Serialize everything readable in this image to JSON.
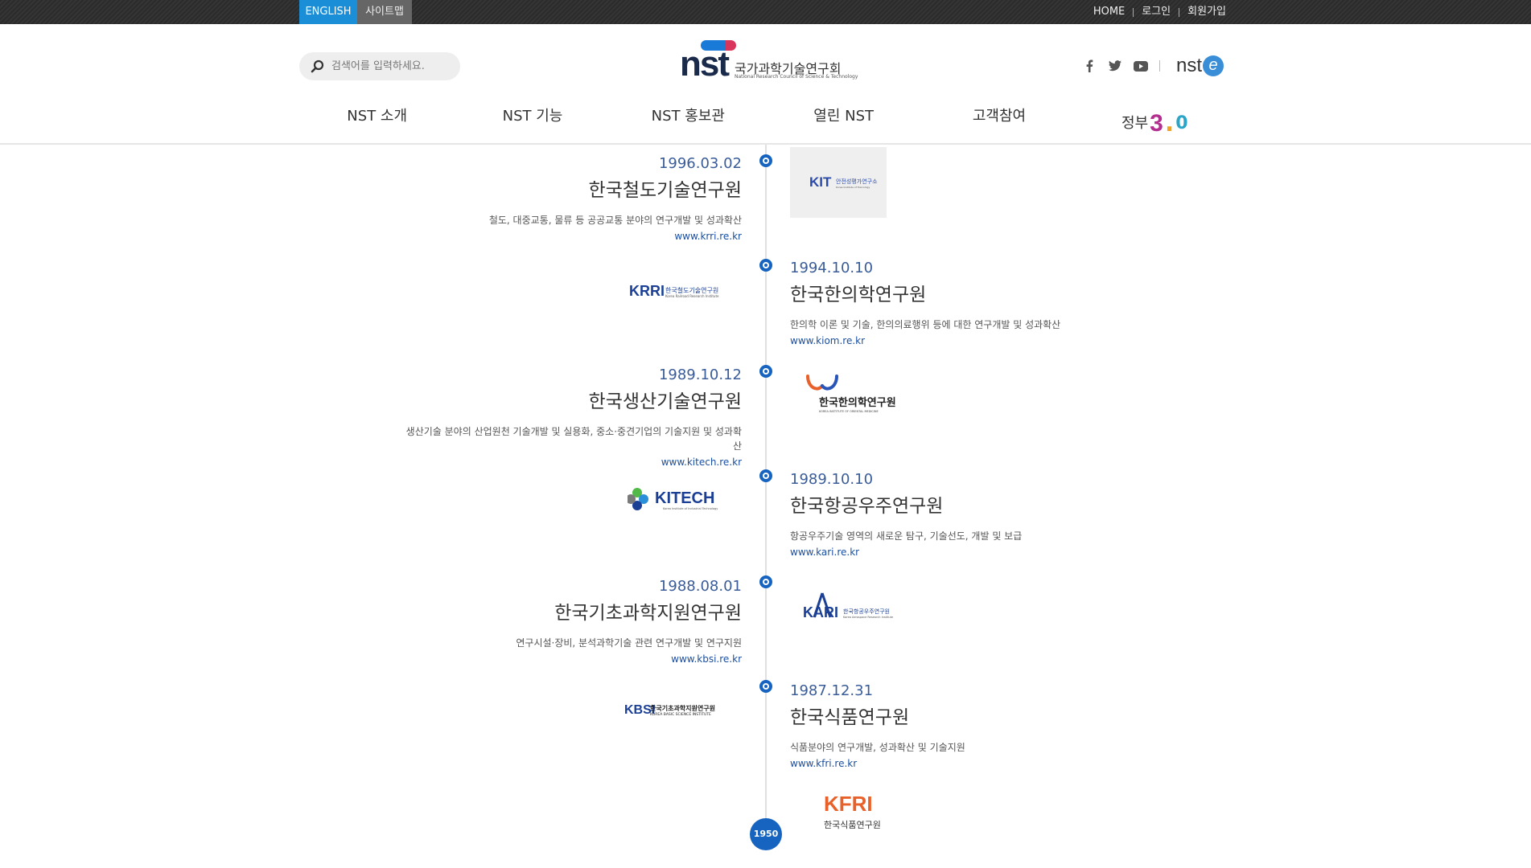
{
  "topbar": {
    "english": "ENGLISH",
    "sitemap": "사이트맵",
    "util": [
      "HOME",
      "로그인",
      "회원가입"
    ]
  },
  "header": {
    "search_placeholder": "검색어를 입력하세요.",
    "logo": {
      "mark": "nst",
      "korean": "국가과학기술연구회",
      "english": "National Research Council of Science & Technology"
    },
    "social": [
      "facebook-icon",
      "twitter-icon",
      "youtube-icon"
    ],
    "nste": {
      "text": "nst",
      "badge": "e"
    }
  },
  "gnb": {
    "items": [
      "NST 소개",
      "NST 기능",
      "NST 홍보관",
      "열린 NST",
      "고객참여"
    ],
    "gov": {
      "text": "정부",
      "num": "3",
      "dot": ".",
      "zero": "0"
    }
  },
  "timeline": {
    "entries": [
      {
        "date": "1996.03.02",
        "name": "한국철도기술연구원",
        "desc": "철도, 대중교통, 물류 등 공공교통 분야의 연구개발 및 성과확산",
        "url": "www.krri.re.kr"
      },
      {
        "date": "1994.10.10",
        "name": "한국한의학연구원",
        "desc": "한의학 이론 및 기술, 한의의료행위 등에 대한 연구개발 및 성과확산",
        "url": "www.kiom.re.kr"
      },
      {
        "date": "1989.10.12",
        "name": "한국생산기술연구원",
        "desc": "생산기술 분야의 산업원천 기술개발 및 실용화, 중소·중견기업의 기술지원 및 성과확산",
        "url": "www.kitech.re.kr"
      },
      {
        "date": "1989.10.10",
        "name": "한국항공우주연구원",
        "desc": "항공우주기술 영역의 새로운 탐구, 기술선도, 개발 및 보급",
        "url": "www.kari.re.kr"
      },
      {
        "date": "1988.08.01",
        "name": "한국기초과학지원연구원",
        "desc": "연구시설·장비, 분석과학기술 관련 연구개발 및 연구지원",
        "url": "www.kbsi.re.kr"
      },
      {
        "date": "1987.12.31",
        "name": "한국식품연구원",
        "desc": "식품분야의 연구개발, 성과확산 및 기술지원",
        "url": "www.kfri.re.kr"
      }
    ],
    "logos": {
      "kit": {
        "mark": "KIT",
        "name": "안전성평가연구소",
        "sub": "Korea Institute of Toxicology"
      },
      "krri": {
        "mark": "KRRI",
        "name": "한국철도기술연구원",
        "sub": "Korea Railroad Research Institute"
      },
      "kiom": {
        "name": "한국한의학연구원",
        "sub": "KOREA INSTITUTE OF ORIENTAL MEDICINE"
      },
      "kitech": {
        "mark": "KITECH",
        "sub": "Korea Institute of Industrial Technology"
      },
      "kari": {
        "mark": "KARI",
        "name": "한국항공우주연구원",
        "sub": "Korea Aerospace Research Institute"
      },
      "kbsi": {
        "mark": "KBSI",
        "name": "한국기초과학지원연구원",
        "sub": "KOREA BASIC SCIENCE INSTITUTE"
      },
      "kfri": {
        "mark": "KFRI",
        "name": "한국식품연구원"
      }
    },
    "year_badge": "1950"
  },
  "colors": {
    "accent": "#1664c0",
    "english_bg": "#1a8fd8",
    "date": "#3a5c99",
    "url": "#1a4fa0"
  }
}
